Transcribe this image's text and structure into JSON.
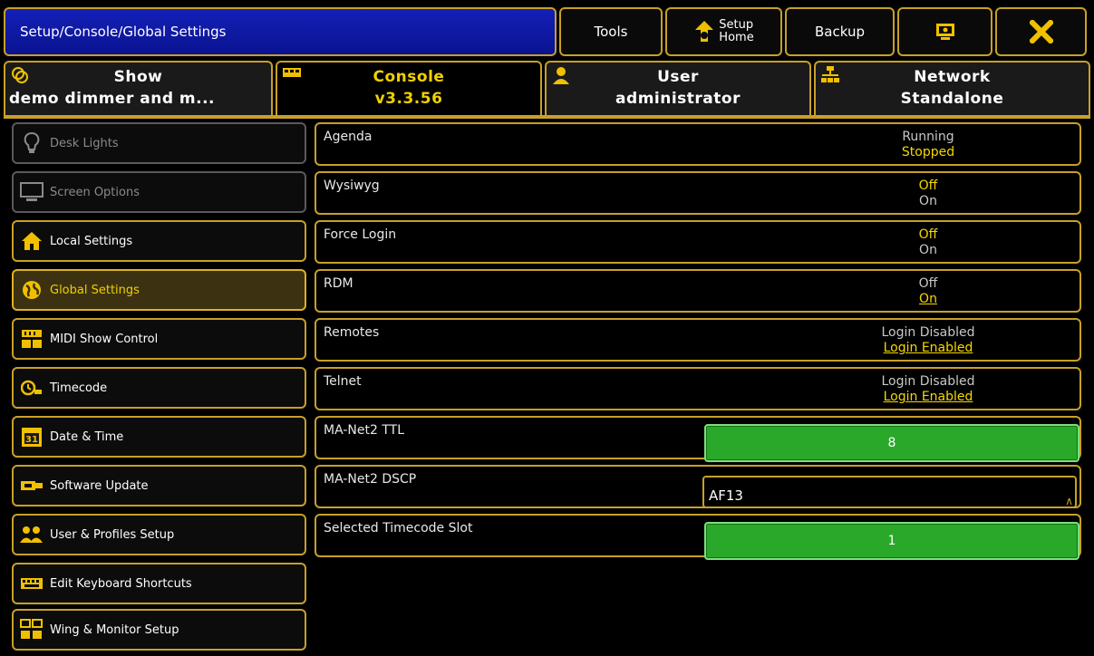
{
  "window": {
    "title": "Setup/Console/Global Settings"
  },
  "toolbar": {
    "tools_label": "Tools",
    "setup_home_line1": "Setup",
    "setup_home_line2": "Home",
    "backup_label": "Backup",
    "close_symbol": "✕"
  },
  "tabs": [
    {
      "line1": "Show",
      "line2": "demo dimmer and m..."
    },
    {
      "line1": "Console",
      "line2": "v3.3.56"
    },
    {
      "line1": "User",
      "line2": "administrator"
    },
    {
      "line1": "Network",
      "line2": "Standalone"
    }
  ],
  "sidebar": {
    "items": [
      {
        "label": "Desk Lights"
      },
      {
        "label": "Screen Options"
      },
      {
        "label": "Local Settings"
      },
      {
        "label": "Global Settings"
      },
      {
        "label": "MIDI Show Control"
      },
      {
        "label": "Timecode"
      },
      {
        "label": "Date & Time"
      },
      {
        "label": "Software Update"
      },
      {
        "label": "User & Profiles Setup"
      },
      {
        "label": "Edit Keyboard Shortcuts"
      },
      {
        "label": "Wing & Monitor Setup"
      }
    ]
  },
  "settings": [
    {
      "name": "Agenda",
      "opt1": "Running",
      "opt2": "Stopped"
    },
    {
      "name": "Wysiwyg",
      "opt1": "Off",
      "opt2": "On"
    },
    {
      "name": "Force Login",
      "opt1": "Off",
      "opt2": "On"
    },
    {
      "name": "RDM",
      "opt1": "Off",
      "opt2": "On"
    },
    {
      "name": "Remotes",
      "opt1": "Login Disabled",
      "opt2": "Login Enabled"
    },
    {
      "name": "Telnet",
      "opt1": "Login Disabled",
      "opt2": "Login Enabled"
    },
    {
      "name": "MA-Net2 TTL",
      "value": "8"
    },
    {
      "name": "MA-Net2 DSCP",
      "value": "AF13"
    },
    {
      "name": "Selected Timecode Slot",
      "value": "1"
    }
  ],
  "colors": {
    "accent": "#c8a028",
    "active_text": "#f0d000",
    "title_blue": "#1420b8",
    "field_green": "#2aa82a"
  }
}
